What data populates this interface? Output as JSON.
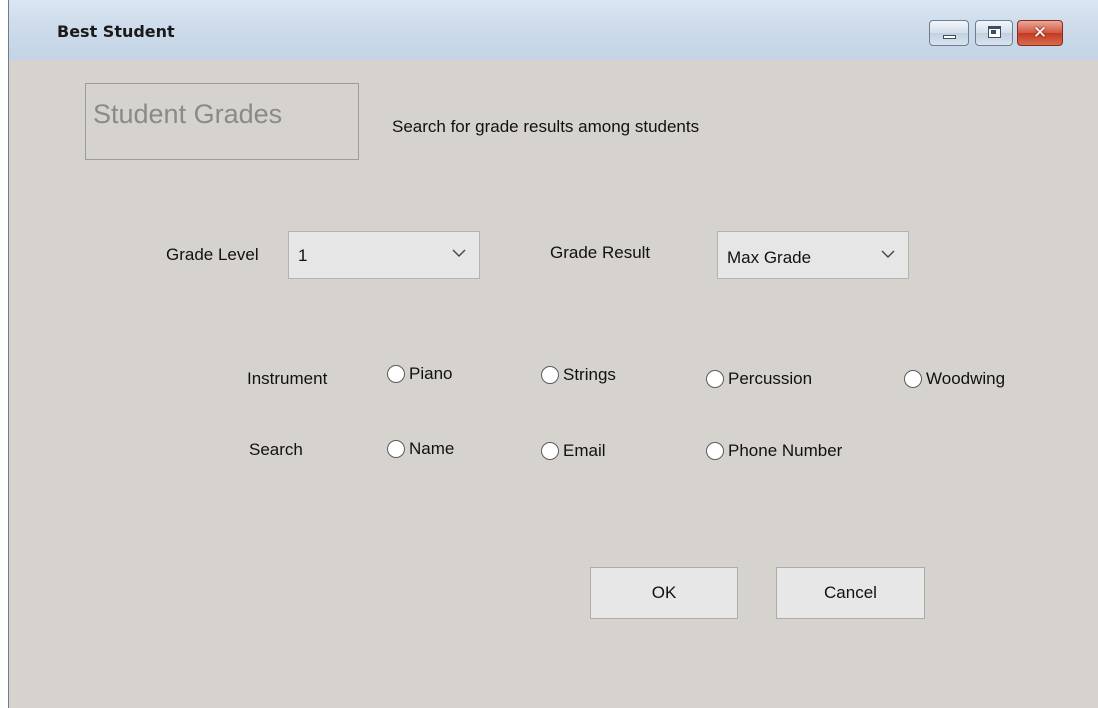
{
  "window": {
    "title": "Best Student",
    "controls": {
      "minimize": "minimize-icon",
      "maximize": "maximize-icon",
      "close": "close-icon"
    }
  },
  "header": {
    "title": "Student Grades",
    "description": "Search for grade results among students"
  },
  "grade_level": {
    "label": "Grade Level",
    "value": "1"
  },
  "grade_result": {
    "label": "Grade Result",
    "value": "Max Grade"
  },
  "instrument": {
    "label": "Instrument",
    "options": [
      "Piano",
      "Strings",
      "Percussion",
      "Woodwing"
    ]
  },
  "search": {
    "label": "Search",
    "options": [
      "Name",
      "Email",
      "Phone Number"
    ]
  },
  "buttons": {
    "ok": "OK",
    "cancel": "Cancel"
  },
  "colors": {
    "window_bg": "#d6d3ce",
    "titlebar": "#cddbea",
    "close_button": "#c23b22"
  }
}
